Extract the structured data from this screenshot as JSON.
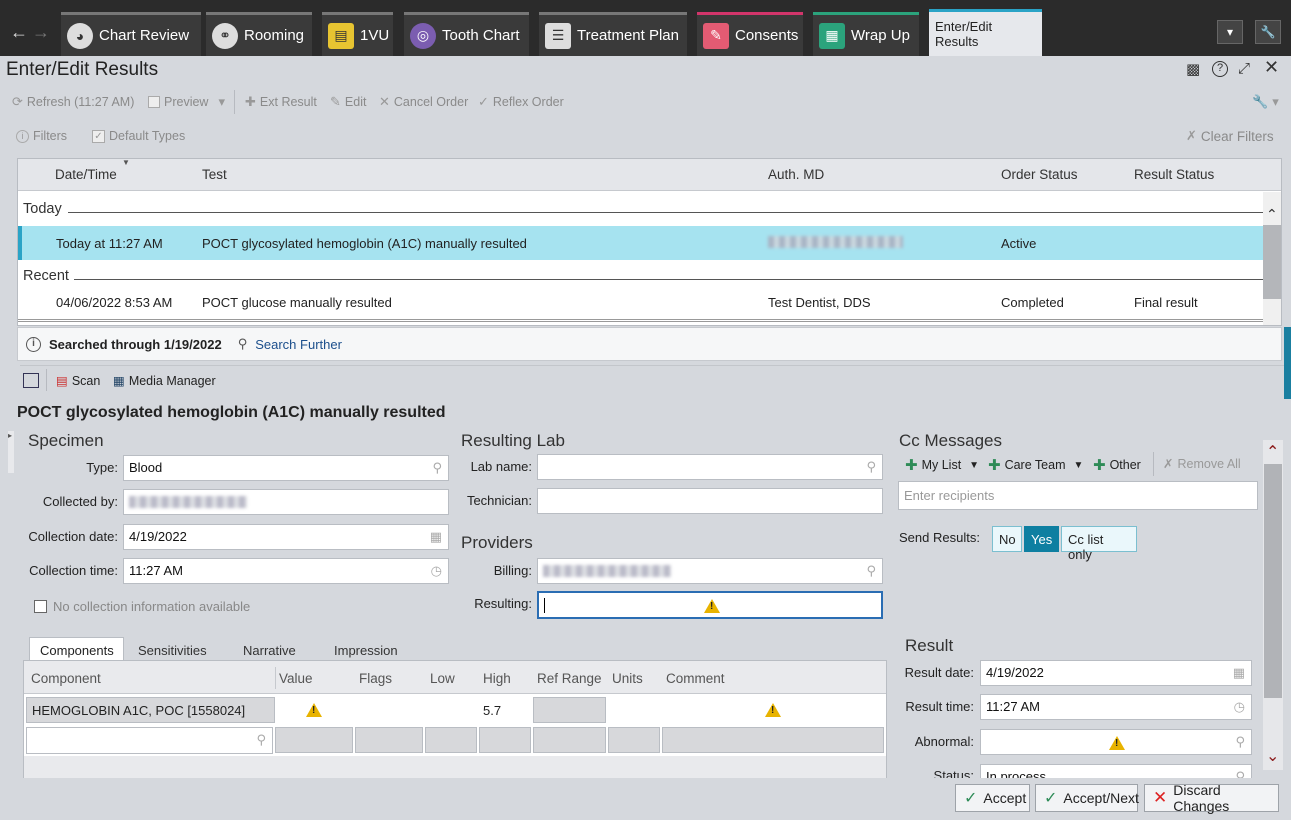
{
  "nav": {
    "back_icon": "back-arrow-icon",
    "forward_icon": "forward-arrow-icon"
  },
  "tabs": [
    {
      "label": "Chart Review",
      "icon": "chart-review-icon"
    },
    {
      "label": "Rooming",
      "icon": "stethoscope-icon"
    },
    {
      "label": "1VU",
      "icon": "1vu-icon"
    },
    {
      "label": "Tooth Chart",
      "icon": "tooth-icon"
    },
    {
      "label": "Treatment Plan",
      "icon": "checklist-icon"
    },
    {
      "label": "Consents",
      "icon": "consents-icon"
    },
    {
      "label": "Wrap Up",
      "icon": "wrap-up-icon"
    },
    {
      "label": "Enter/Edit Results",
      "active": true
    }
  ],
  "activity": {
    "title": "Enter/Edit Results"
  },
  "toolbar": {
    "refresh": "Refresh (11:27 AM)",
    "preview": "Preview",
    "ext_result": "Ext Result",
    "edit": "Edit",
    "cancel_order": "Cancel Order",
    "reflex_order": "Reflex Order"
  },
  "filters": {
    "filters_label": "Filters",
    "default_types": "Default Types",
    "clear_filters": "Clear Filters"
  },
  "grid": {
    "headers": {
      "date": "Date/Time",
      "test": "Test",
      "auth": "Auth. MD",
      "order_status": "Order Status",
      "result_status": "Result Status"
    },
    "groups": {
      "today": "Today",
      "recent": "Recent"
    },
    "rows": [
      {
        "date": "Today at 11:27 AM",
        "test": "POCT glycosylated hemoglobin (A1C) manually resulted",
        "auth": "",
        "order_status": "Active",
        "result_status": ""
      },
      {
        "date": "04/06/2022 8:53 AM",
        "test": "POCT glucose manually resulted",
        "auth": "Test Dentist, DDS",
        "order_status": "Completed",
        "result_status": "Final result"
      }
    ]
  },
  "search": {
    "searched": "Searched through 1/19/2022",
    "further": "Search Further"
  },
  "actions": {
    "scan": "Scan",
    "media": "Media Manager"
  },
  "detail": {
    "title": "POCT glycosylated hemoglobin (A1C) manually resulted"
  },
  "specimen": {
    "header": "Specimen",
    "type_label": "Type:",
    "type_value": "Blood",
    "collected_by_label": "Collected by:",
    "collection_date_label": "Collection date:",
    "collection_date": "4/19/2022",
    "collection_time_label": "Collection time:",
    "collection_time": "11:27 AM",
    "no_info": "No collection information available"
  },
  "lab": {
    "header": "Resulting Lab",
    "lab_name_label": "Lab name:",
    "technician_label": "Technician:"
  },
  "providers": {
    "header": "Providers",
    "billing_label": "Billing:",
    "resulting_label": "Resulting:"
  },
  "cc": {
    "header": "Cc Messages",
    "my_list": "My List",
    "care_team": "Care Team",
    "other": "Other",
    "remove_all": "Remove All",
    "placeholder": "Enter recipients",
    "send_label": "Send Results:",
    "no": "No",
    "yes": "Yes",
    "cc_only": "Cc list only"
  },
  "subtabs": [
    "Components",
    "Sensitivities",
    "Narrative",
    "Impression"
  ],
  "components": {
    "headers": {
      "component": "Component",
      "value": "Value",
      "flags": "Flags",
      "low": "Low",
      "high": "High",
      "ref": "Ref Range",
      "units": "Units",
      "comment": "Comment"
    },
    "row": {
      "component": "HEMOGLOBIN A1C, POC [1558024]",
      "high": "5.7"
    }
  },
  "result": {
    "header": "Result",
    "date_label": "Result date:",
    "date": "4/19/2022",
    "time_label": "Result time:",
    "time": "11:27 AM",
    "abnormal_label": "Abnormal:",
    "status_label": "Status:",
    "status": "In process"
  },
  "buttons": {
    "accept": "Accept",
    "accept_next": "Accept/Next",
    "discard": "Discard Changes"
  }
}
